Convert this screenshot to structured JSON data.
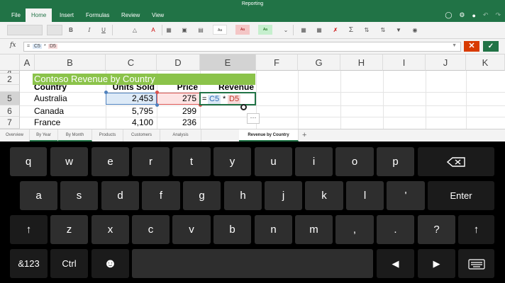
{
  "app": {
    "title": "Reporting"
  },
  "ribbon_tabs": [
    "File",
    "Home",
    "Insert",
    "Formulas",
    "Review",
    "View"
  ],
  "active_tab": "Home",
  "ribbon": {
    "bold": "B",
    "italic": "I",
    "underline": "U",
    "style_normal": "Aa",
    "style_bad": "Aa",
    "style_good": "Aa",
    "autosum": "Σ"
  },
  "formula_bar": {
    "fx": "fx",
    "tokens": [
      "=",
      "C5",
      "*",
      "D5"
    ]
  },
  "columns": [
    "A",
    "B",
    "C",
    "D",
    "E",
    "F",
    "G",
    "H",
    "I",
    "J",
    "K"
  ],
  "selected_column": "E",
  "rows": [
    "4",
    "2",
    "5",
    "6",
    "7"
  ],
  "sheet": {
    "title": "Contoso Revenue by Country",
    "headers": {
      "country": "Country",
      "units": "Units Sold",
      "price": "Price",
      "revenue": "Revenue"
    },
    "data": [
      {
        "country": "Australia",
        "units": "2,453",
        "price": "275"
      },
      {
        "country": "Canada",
        "units": "5,795",
        "price": "299"
      },
      {
        "country": "France",
        "units": "4,100",
        "price": "236"
      }
    ],
    "edit": {
      "eq": "=",
      "ref1": "C5",
      "op": "*",
      "ref2": "D5"
    },
    "more": "···"
  },
  "sheet_tabs": [
    "Overview",
    "By Year",
    "By Month",
    "Products",
    "Customers",
    "Analysis",
    "Revenue by Country"
  ],
  "active_sheet": "Revenue by Country",
  "keyboard": {
    "row1": [
      "q",
      "w",
      "e",
      "r",
      "t",
      "y",
      "u",
      "i",
      "o",
      "p"
    ],
    "row2": [
      "a",
      "s",
      "d",
      "f",
      "g",
      "h",
      "j",
      "k",
      "'"
    ],
    "enter": "Enter",
    "row3": [
      "↑",
      "z",
      "x",
      "c",
      "v",
      "b",
      "n",
      "m",
      ",",
      ".",
      "?",
      "↑"
    ],
    "row4": {
      "num": "&123",
      "ctrl": "Ctrl",
      "emoji": "☻",
      "left": "◀",
      "right": "▶"
    }
  },
  "colors": {
    "excel_green": "#217346",
    "title_fill": "#8bc34a",
    "cancel": "#d83b01"
  }
}
